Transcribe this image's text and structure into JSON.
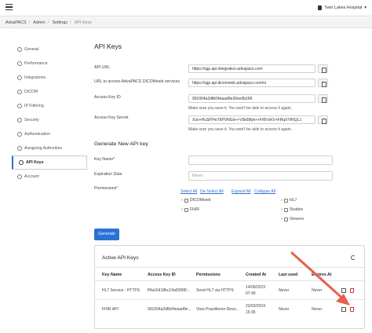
{
  "header": {
    "hospital": "Twin Lakes Hospital",
    "caret": "▾"
  },
  "breadcrumb": [
    "AdvaPACS",
    "Admin",
    "Settings",
    "API Keys"
  ],
  "sidebar": {
    "items": [
      {
        "label": "General",
        "icon": "gear-icon"
      },
      {
        "label": "Performance",
        "icon": "gauge-icon"
      },
      {
        "label": "Integrations",
        "icon": "plug-icon"
      },
      {
        "label": "DICOM",
        "icon": "dicom-icon"
      },
      {
        "label": "IP Filtering",
        "icon": "filter-icon"
      },
      {
        "label": "Security",
        "icon": "shield-icon"
      },
      {
        "label": "Authentication",
        "icon": "user-lock-icon"
      },
      {
        "label": "Assigning Authorities",
        "icon": "building-icon"
      },
      {
        "label": "API Keys",
        "icon": "key-icon"
      },
      {
        "label": "Account",
        "icon": "account-icon"
      }
    ],
    "active": "API Keys"
  },
  "page_title": "API Keys",
  "api_info": {
    "api_url_label": "API URL",
    "api_url_value": "https://sgp.api.integration.advapacs.com",
    "dicomweb_label": "URL to access AdvaPACS DICOMweb services",
    "dicomweb_value": "https://sgp.api.dicomweb.advapacs.com/rs",
    "key_id_label": "Access Key ID",
    "key_id_value": "991004a2dfb04eaad9e30ee0b186",
    "key_id_note": "Make sure you save it. You won't be able to access it again.",
    "secret_label": "Access Key Secret",
    "secret_value": "Xzo+HuSFPm76PVNGd++V5k6Byb++FMVvKV+FRqXY/RQL1",
    "secret_note": "Make sure you save it. You won't be able to access it again."
  },
  "generate": {
    "title": "Generate New API key",
    "key_name_label": "Key Name*",
    "key_name_value": "",
    "expiration_label": "Expiration Date",
    "expiration_placeholder": "Never",
    "permissions_label": "Permissions*",
    "select_all": "Select All",
    "deselect_all": "De-Select All",
    "expand_all": "Expand All",
    "collapse_all": "Collapse All",
    "perms_left": [
      "DICOMweb",
      "FHIR"
    ],
    "perms_right": [
      "HL7",
      "Studies",
      "Viewers"
    ],
    "button": "Generate"
  },
  "active_keys": {
    "title": "Active API Keys",
    "columns": [
      "Key Name",
      "Access Key ID",
      "Permissions",
      "Created At",
      "Last used",
      "Expires At"
    ],
    "rows": [
      {
        "name": "HL7 Service - HTTPS",
        "key_id": "ff4a16418bc24af3999f...",
        "permissions": "Send HL7 via HTTPS",
        "created_date": "14/09/2023",
        "created_time": "07:49",
        "last_used": "Never",
        "expires": "Never"
      },
      {
        "name": "FHIR API",
        "key_id": "991004a2dfb04eaad9e...",
        "permissions": "View Practitioner Reso...",
        "created_date": "22/03/2024",
        "created_time": "16:35",
        "last_used": "Never",
        "expires": "Never"
      }
    ]
  },
  "colors": {
    "accent": "#2a72d6",
    "annotation_arrow": "#e8604c",
    "delete": "#d33333"
  }
}
